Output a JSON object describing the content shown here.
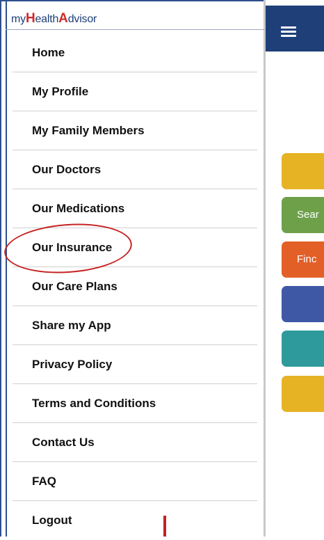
{
  "logo": {
    "part1": "my",
    "part2": "H",
    "part3": "ealth",
    "part4": "A",
    "part5": "dvisor"
  },
  "menu": {
    "items": [
      {
        "label": "Home"
      },
      {
        "label": "My Profile"
      },
      {
        "label": "My Family Members"
      },
      {
        "label": "Our Doctors"
      },
      {
        "label": "Our Medications"
      },
      {
        "label": "Our Insurance"
      },
      {
        "label": "Our Care Plans"
      },
      {
        "label": "Share my App"
      },
      {
        "label": "Privacy Policy"
      },
      {
        "label": "Terms and Conditions"
      },
      {
        "label": "Contact Us"
      },
      {
        "label": "FAQ"
      },
      {
        "label": "Logout"
      }
    ]
  },
  "background_tiles": [
    {
      "label": "",
      "color": "#e6b325"
    },
    {
      "label": "Sear",
      "color": "#6ea04a"
    },
    {
      "label": "Finc",
      "color": "#e35f28"
    },
    {
      "label": "",
      "color": "#3f58a6"
    },
    {
      "label": "",
      "color": "#2f9a9c"
    },
    {
      "label": "",
      "color": "#e6b325"
    }
  ],
  "colors": {
    "header": "#1e3f78",
    "annotation": "#c62222"
  },
  "icons": {
    "menu": "hamburger-icon"
  }
}
